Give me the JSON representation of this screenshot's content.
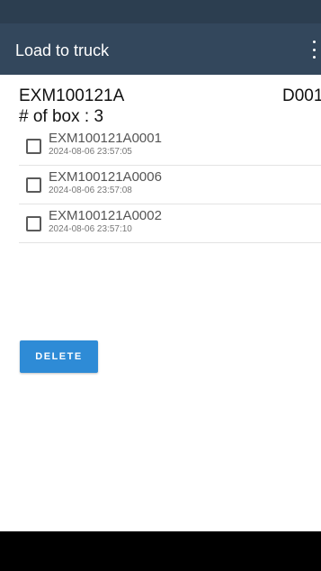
{
  "appbar": {
    "title": "Load to truck",
    "menu_icon": "more-vertical-icon",
    "color": "#33475c"
  },
  "order": {
    "id": "EXM100121A",
    "code": "D001",
    "box_count": "# of box : 3"
  },
  "boxes": [
    {
      "code": "EXM100121A0001",
      "time": "2024-08-06 23:57:05",
      "checked": false
    },
    {
      "code": "EXM100121A0006",
      "time": "2024-08-06 23:57:08",
      "checked": false
    },
    {
      "code": "EXM100121A0002",
      "time": "2024-08-06 23:57:10",
      "checked": false
    }
  ],
  "actions": {
    "delete_label": "DELETE",
    "delete_color": "#2e8bd6"
  }
}
